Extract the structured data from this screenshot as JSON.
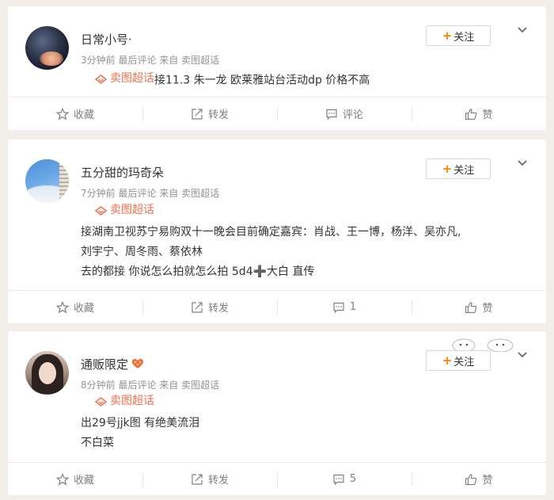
{
  "colors": {
    "accent": "#ff8200",
    "topic": "#eb7350",
    "muted": "#939393",
    "background": "#f2eeea"
  },
  "icons": {
    "follow": "plus-icon",
    "menu": "chevron-down-icon",
    "topic": "supertopic-diamond-icon",
    "favorite": "star-icon",
    "repost": "repost-icon",
    "comment": "comment-icon",
    "like": "thumbs-up-icon"
  },
  "posts": [
    {
      "username": "日常小号·",
      "meta": "3分钟前  最后评论  来自 卖图超话",
      "follow_label": "关注",
      "topic": "卖图超话",
      "lines": [
        "接11.3 朱一龙 欧莱雅站台活动dp 价格不高"
      ],
      "actions": {
        "favorite": "收藏",
        "repost": "转发",
        "comment": "评论",
        "like": "赞"
      }
    },
    {
      "username": "五分甜的玛奇朵",
      "meta": "7分钟前  最后评论  来自 卖图超话",
      "follow_label": "关注",
      "topic": "卖图超话",
      "lines": [
        "接湖南卫视苏宁易购双十一晚会目前确定嘉宾：肖战、王一博，杨洋、吴亦凡,",
        "刘宇宁、周冬雨、蔡依林",
        "去的都接 你说怎么拍就怎么拍 5d4➕大白 直传"
      ],
      "actions": {
        "favorite": "收藏",
        "repost": "转发",
        "comment": "1",
        "like": "赞"
      }
    },
    {
      "username": "通贩限定",
      "meta": "8分钟前  最后评论  来自 卖图超话",
      "follow_label": "关注",
      "topic": "卖图超话",
      "lines": [
        "出29号jjk图 有绝美流泪",
        "不白菜"
      ],
      "actions": {
        "favorite": "收藏",
        "repost": "转发",
        "comment": "5",
        "like": "赞"
      }
    }
  ]
}
